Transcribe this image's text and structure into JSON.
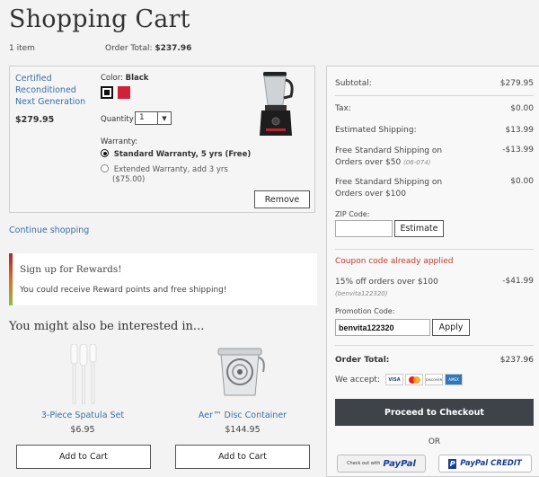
{
  "page": {
    "title": "Shopping Cart",
    "item_count": "1 item",
    "order_total_label": "Order Total:",
    "order_total_value": "$237.96"
  },
  "cart_item": {
    "name_lines": [
      "Certified",
      "Reconditioned",
      "Next Generation"
    ],
    "price": "$279.95",
    "color_label": "Color:",
    "color_value": "Black",
    "swatches": [
      "#111111",
      "#d0203a"
    ],
    "quantity_label": "Quantity",
    "quantity_value": "1",
    "warranty_label": "Warranty:",
    "warranty_opt1": "Standard Warranty, 5 yrs (Free)",
    "warranty_opt2_line1": "Extended Warranty, add 3 yrs",
    "warranty_opt2_line2": "($75.00)",
    "remove_label": "Remove"
  },
  "continue_label": "Continue shopping",
  "rewards": {
    "title": "Sign up for Rewards!",
    "text": "You could receive Reward points and free shipping!"
  },
  "recommend": {
    "title": "You might also be interested in...",
    "products": [
      {
        "name": "3-Piece Spatula Set",
        "price": "$6.95",
        "button": "Add to Cart"
      },
      {
        "name": "Aer™ Disc Container",
        "price": "$144.95",
        "button": "Add to Cart"
      }
    ]
  },
  "summary": {
    "subtotal_label": "Subtotal:",
    "subtotal_value": "$279.95",
    "tax_label": "Tax:",
    "tax_value": "$0.00",
    "shipping_label": "Estimated Shipping:",
    "shipping_value": "$13.99",
    "free_ship1_line1": "Free Standard Shipping on",
    "free_ship1_line2": "Orders over $50",
    "free_ship1_code": "(06-074)",
    "free_ship1_value": "-$13.99",
    "free_ship2_line1": "Free Standard Shipping on",
    "free_ship2_line2": "Orders over $100",
    "free_ship2_value": "$0.00",
    "zip_label": "ZIP Code:",
    "zip_value": "",
    "estimate_label": "Estimate",
    "coupon_error": "Coupon code already applied",
    "promo_line": "15% off orders over $100",
    "promo_code": "(benvita122320)",
    "promo_value": "-$41.99",
    "promo_code_label": "Promotion Code:",
    "promo_input_value": "benvita122320",
    "apply_label": "Apply",
    "order_total_label": "Order Total:",
    "order_total_value": "$237.96",
    "accept_label": "We accept:",
    "cards": [
      "VISA",
      "MC",
      "DISCOVER",
      "AMEX"
    ],
    "checkout_label": "Proceed to Checkout",
    "or_label": "OR",
    "paypal_prefix": "Check out with",
    "paypal_word": "PayPal",
    "paypal_credit": "PayPal CREDIT"
  },
  "colors": {
    "accent": "#3a6ea5",
    "error": "#c0392b",
    "checkout_bg": "#3d4349"
  }
}
